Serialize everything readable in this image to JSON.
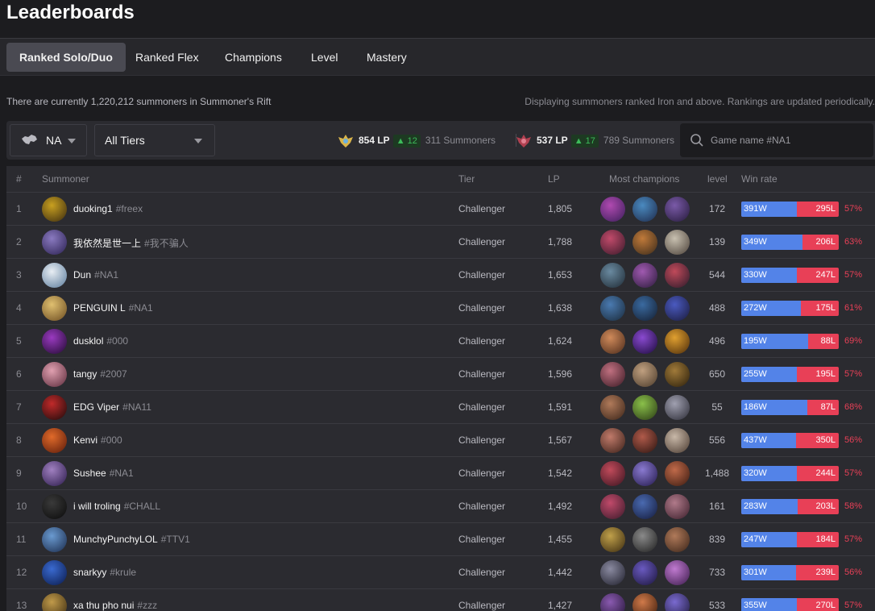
{
  "page": {
    "title": "Leaderboards"
  },
  "tabs": [
    {
      "label": "Ranked Solo/Duo",
      "active": true
    },
    {
      "label": "Ranked Flex",
      "active": false
    },
    {
      "label": "Champions",
      "active": false
    },
    {
      "label": "Level",
      "active": false
    },
    {
      "label": "Mastery",
      "active": false
    }
  ],
  "info": {
    "summoner_count_text": "There are currently 1,220,212 summoners in Summoner's Rift",
    "ranking_note": "Displaying summoners ranked Iron and above. Rankings are updated periodically."
  },
  "filters": {
    "region": "NA",
    "tier": "All Tiers",
    "region_icon": "region-map-icon"
  },
  "cutoffs": [
    {
      "emblem": "challenger-emblem-icon",
      "lp": "854 LP",
      "delta": "12",
      "count": "311 Summoners"
    },
    {
      "emblem": "grandmaster-emblem-icon",
      "lp": "537 LP",
      "delta": "17",
      "count": "789 Summoners"
    }
  ],
  "search": {
    "placeholder": "Game name #NA1",
    "value": ""
  },
  "columns": {
    "rank": "#",
    "summoner": "Summoner",
    "tier": "Tier",
    "lp": "LP",
    "champions": "Most champions",
    "level": "level",
    "winrate": "Win rate"
  },
  "colors": {
    "win": "#5383e8",
    "loss": "#e84057",
    "delta_green": "#3dbb5a"
  },
  "rows": [
    {
      "rank": "1",
      "name": "duoking1",
      "tag": "#freex",
      "tier": "Challenger",
      "lp": "1,805",
      "level": "172",
      "wins": "391W",
      "losses": "295L",
      "winrate": "57%",
      "win_fraction": 0.57,
      "avatar": [
        "#c8a020",
        "#3a2a10"
      ],
      "champs": [
        [
          "#b04ab0",
          "#3a1e5a"
        ],
        [
          "#4a8ac0",
          "#1e2a4a"
        ],
        [
          "#7a5aa8",
          "#251a3a"
        ]
      ]
    },
    {
      "rank": "2",
      "name": "我依然是世一上",
      "tag": "#我不骗人",
      "tier": "Challenger",
      "lp": "1,788",
      "level": "139",
      "wins": "349W",
      "losses": "206L",
      "winrate": "63%",
      "win_fraction": 0.63,
      "avatar": [
        "#8a7ac0",
        "#2a2050"
      ],
      "champs": [
        [
          "#c04a6a",
          "#3a1a2a"
        ],
        [
          "#c07a3a",
          "#3a2a1a"
        ],
        [
          "#c8c0b0",
          "#4a4038"
        ]
      ]
    },
    {
      "rank": "3",
      "name": "Dun",
      "tag": "#NA1",
      "tier": "Challenger",
      "lp": "1,653",
      "level": "544",
      "wins": "330W",
      "losses": "247L",
      "winrate": "57%",
      "win_fraction": 0.57,
      "avatar": [
        "#e8eef4",
        "#5a7a9a"
      ],
      "champs": [
        [
          "#6a8aa0",
          "#1e2a34"
        ],
        [
          "#a05ab0",
          "#2a1a3a"
        ],
        [
          "#c04a5a",
          "#2a1a2a"
        ]
      ]
    },
    {
      "rank": "4",
      "name": "PENGUIN L",
      "tag": "#NA1",
      "tier": "Challenger",
      "lp": "1,638",
      "level": "488",
      "wins": "272W",
      "losses": "175L",
      "winrate": "61%",
      "win_fraction": 0.61,
      "avatar": [
        "#e0c070",
        "#6a4a20"
      ],
      "champs": [
        [
          "#4a7ab0",
          "#1a2a3a"
        ],
        [
          "#3a6aa0",
          "#141e30"
        ],
        [
          "#4a5ac0",
          "#1a1a3a"
        ]
      ]
    },
    {
      "rank": "5",
      "name": "dusklol",
      "tag": "#000",
      "tier": "Challenger",
      "lp": "1,624",
      "level": "496",
      "wins": "195W",
      "losses": "88L",
      "winrate": "69%",
      "win_fraction": 0.69,
      "avatar": [
        "#9a3ac0",
        "#200a30"
      ],
      "champs": [
        [
          "#d08a5a",
          "#4a2a1a"
        ],
        [
          "#8a4ad0",
          "#1a0a3a"
        ],
        [
          "#e0a030",
          "#4a2a0a"
        ]
      ]
    },
    {
      "rank": "6",
      "name": "tangy",
      "tag": "#2007",
      "tier": "Challenger",
      "lp": "1,596",
      "level": "650",
      "wins": "255W",
      "losses": "195L",
      "winrate": "57%",
      "win_fraction": 0.57,
      "avatar": [
        "#e0a0b0",
        "#5a2a3a"
      ],
      "champs": [
        [
          "#c07080",
          "#3a1a24"
        ],
        [
          "#c0a080",
          "#4a3a2a"
        ],
        [
          "#a07a3a",
          "#2a1e0a"
        ]
      ]
    },
    {
      "rank": "7",
      "name": "EDG Viper",
      "tag": "#NA11",
      "tier": "Challenger",
      "lp": "1,591",
      "level": "55",
      "wins": "186W",
      "losses": "87L",
      "winrate": "68%",
      "win_fraction": 0.68,
      "avatar": [
        "#c02a2a",
        "#1a0a0a"
      ],
      "champs": [
        [
          "#b07a5a",
          "#3a2418"
        ],
        [
          "#8ac04a",
          "#2a3a14"
        ],
        [
          "#a0a0b0",
          "#2a2a34"
        ]
      ]
    },
    {
      "rank": "8",
      "name": "Kenvi",
      "tag": "#000",
      "tier": "Challenger",
      "lp": "1,567",
      "level": "556",
      "wins": "437W",
      "losses": "350L",
      "winrate": "56%",
      "win_fraction": 0.56,
      "avatar": [
        "#e06a2a",
        "#5a1a0a"
      ],
      "champs": [
        [
          "#c07a6a",
          "#3a2018"
        ],
        [
          "#b05a4a",
          "#2a1410"
        ],
        [
          "#c8b8a8",
          "#4a3a30"
        ]
      ]
    },
    {
      "rank": "9",
      "name": "Sushee",
      "tag": "#NA1",
      "tier": "Challenger",
      "lp": "1,542",
      "level": "1,488",
      "wins": "320W",
      "losses": "244L",
      "winrate": "57%",
      "win_fraction": 0.57,
      "avatar": [
        "#a080c0",
        "#2a1a4a"
      ],
      "champs": [
        [
          "#c04a5a",
          "#3a1420"
        ],
        [
          "#8a7ad0",
          "#22184a"
        ],
        [
          "#c06a4a",
          "#3a1a10"
        ]
      ]
    },
    {
      "rank": "10",
      "name": "i will troling",
      "tag": "#CHALL",
      "tier": "Challenger",
      "lp": "1,492",
      "level": "161",
      "wins": "283W",
      "losses": "203L",
      "winrate": "58%",
      "win_fraction": 0.58,
      "avatar": [
        "#3a3a3a",
        "#0a0a0a"
      ],
      "champs": [
        [
          "#c04a6a",
          "#3a1a2a"
        ],
        [
          "#4a6ab0",
          "#141a3a"
        ],
        [
          "#b07a8a",
          "#3a1e2a"
        ]
      ]
    },
    {
      "rank": "11",
      "name": "MunchyPunchyLOL",
      "tag": "#TTV1",
      "tier": "Challenger",
      "lp": "1,455",
      "level": "839",
      "wins": "247W",
      "losses": "184L",
      "winrate": "57%",
      "win_fraction": 0.57,
      "avatar": [
        "#6a9ad0",
        "#1a2a4a"
      ],
      "champs": [
        [
          "#c0a04a",
          "#3a2a10"
        ],
        [
          "#8a8a8a",
          "#1e1e1e"
        ],
        [
          "#b07a5a",
          "#3a2418"
        ]
      ]
    },
    {
      "rank": "12",
      "name": "snarkyy",
      "tag": "#krule",
      "tier": "Challenger",
      "lp": "1,442",
      "level": "733",
      "wins": "301W",
      "losses": "239L",
      "winrate": "56%",
      "win_fraction": 0.56,
      "avatar": [
        "#3a6ad0",
        "#0a1a4a"
      ],
      "champs": [
        [
          "#8a8aa0",
          "#1e1e2a"
        ],
        [
          "#6a5ac0",
          "#1a143a"
        ],
        [
          "#c07ad0",
          "#3a1a4a"
        ]
      ]
    },
    {
      "rank": "13",
      "name": "xa thu pho nui",
      "tag": "#zzz",
      "tier": "Challenger",
      "lp": "1,427",
      "level": "533",
      "wins": "355W",
      "losses": "270L",
      "winrate": "57%",
      "win_fraction": 0.57,
      "avatar": [
        "#c09a4a",
        "#3a2a10"
      ],
      "champs": [
        [
          "#8a5ab0",
          "#221434"
        ],
        [
          "#d07a4a",
          "#3a1a0a"
        ],
        [
          "#7a6ad0",
          "#1e1a3a"
        ]
      ]
    }
  ]
}
